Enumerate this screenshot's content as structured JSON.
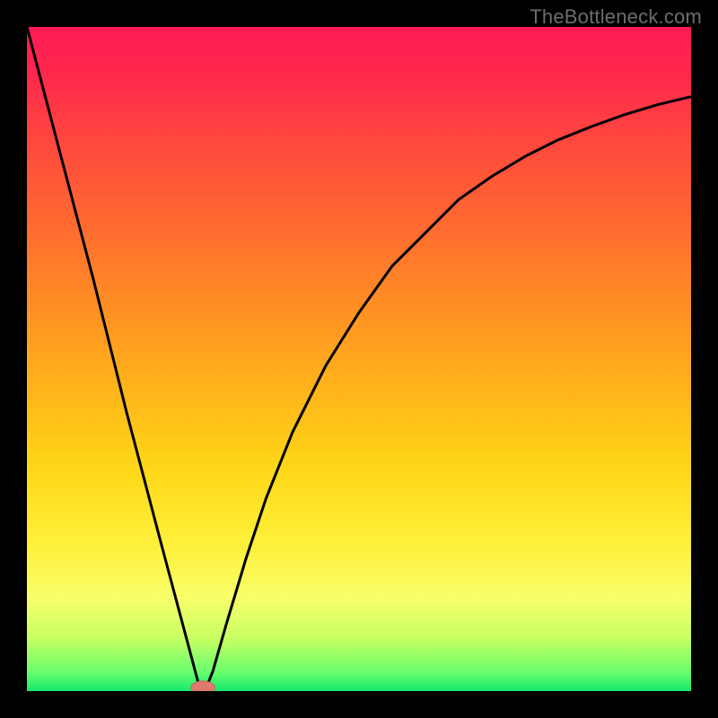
{
  "watermark": "TheBottleneck.com",
  "colors": {
    "frame": "#000000",
    "curve": "#000000",
    "marker_fill": "#df7a70",
    "marker_stroke": "#cf6058"
  },
  "chart_data": {
    "type": "line",
    "title": "",
    "xlabel": "",
    "ylabel": "",
    "xlim": [
      0,
      100
    ],
    "ylim": [
      0,
      100
    ],
    "grid": false,
    "description": "Bottleneck-style curve: steep linear descent from top-left to a minimum near x≈26, then asymptotic rise toward top-right. Single pink rounded marker at the minimum.",
    "series": [
      {
        "name": "bottleneck-curve",
        "x": [
          0,
          5,
          10,
          15,
          20,
          24,
          26,
          27,
          28,
          30,
          33,
          36,
          40,
          45,
          50,
          55,
          60,
          65,
          70,
          75,
          80,
          85,
          90,
          95,
          100
        ],
        "y": [
          100,
          81,
          62,
          42,
          23,
          8,
          0.5,
          0.5,
          3,
          10,
          20,
          29,
          39,
          49,
          57,
          64,
          69,
          74,
          77.5,
          80.5,
          83,
          85,
          86.8,
          88.3,
          89.5
        ]
      }
    ],
    "marker": {
      "x": 26.5,
      "y": 0.5,
      "rx": 1.8,
      "ry": 1.0
    }
  }
}
